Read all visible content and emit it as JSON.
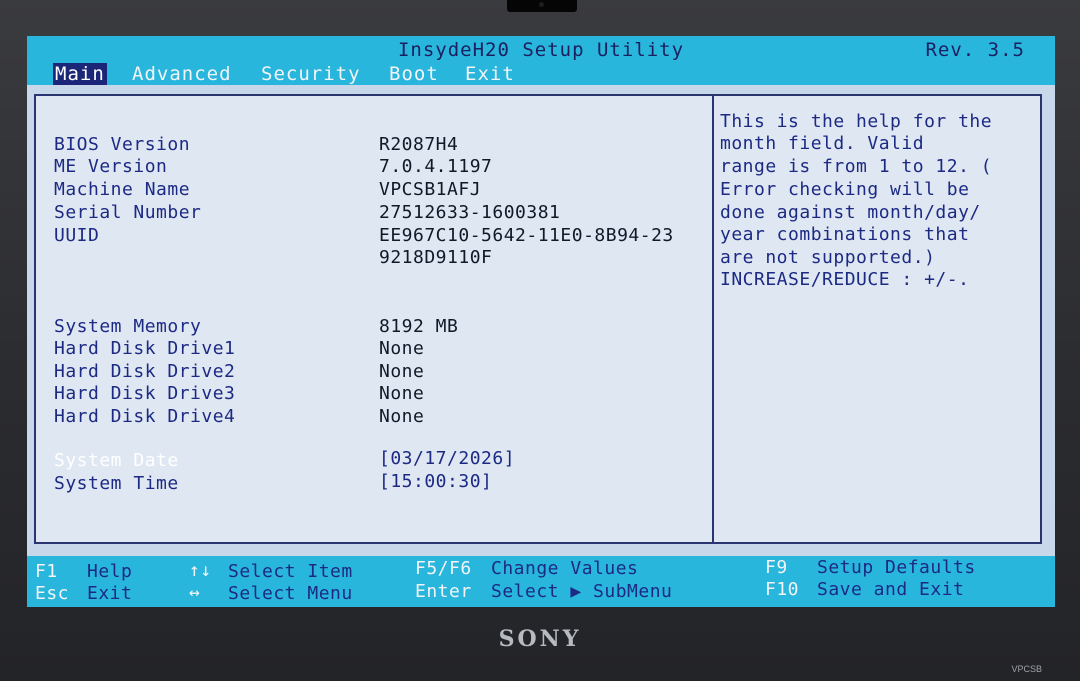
{
  "header": {
    "title": "InsydeH20 Setup Utility",
    "rev": "Rev. 3.5"
  },
  "menu": {
    "main": "Main",
    "advanced": "Advanced",
    "security": "Security",
    "boot": "Boot",
    "exit": "Exit"
  },
  "info": [
    {
      "label": "BIOS Version",
      "value": "R2087H4"
    },
    {
      "label": "ME Version",
      "value": "7.0.4.1197"
    },
    {
      "label": "Machine Name",
      "value": "VPCSB1AFJ"
    },
    {
      "label": "Serial Number",
      "value": "27512633-1600381"
    },
    {
      "label": "UUID",
      "value": "EE967C10-5642-11E0-8B94-23",
      "value2": "9218D9110F"
    }
  ],
  "hardware": [
    {
      "label": "System Memory",
      "value": "8192 MB"
    },
    {
      "label": "Hard Disk Drive1",
      "value": "None"
    },
    {
      "label": "Hard Disk Drive2",
      "value": "None"
    },
    {
      "label": "Hard Disk Drive3",
      "value": "None"
    },
    {
      "label": "Hard Disk Drive4",
      "value": "None"
    }
  ],
  "datetime": {
    "date_label": "System Date",
    "date_value": "[03/17/2026]",
    "time_label": "System Time",
    "time_value": "[15:00:30]"
  },
  "help": [
    "This is the help for the",
    "month field. Valid",
    "range is from 1 to 12. (",
    "Error checking will be",
    "done against month/day/",
    "year combinations that",
    "are not supported.)",
    "INCREASE/REDUCE : +/-."
  ],
  "footer": {
    "f1_key": "F1",
    "f1_desc": "Help",
    "esc_key": "Esc",
    "esc_desc": "Exit",
    "arrows_ud_key": "↑↓",
    "arrows_ud_desc": "Select Item",
    "arrows_lr_key": "↔",
    "arrows_lr_desc": "Select Menu",
    "f5f6_key": "F5/F6",
    "f5f6_desc": "Change Values",
    "enter_key": "Enter",
    "enter_desc": "Select ▶ SubMenu",
    "f9_key": "F9",
    "f9_desc": "Setup Defaults",
    "f10_key": "F10",
    "f10_desc": "Save and Exit"
  },
  "brand": {
    "logo": "SONY",
    "model": "VPCSB"
  },
  "colors": {
    "accent_cyan": "#29b6dc",
    "selection_navy": "#1c2678",
    "panel_bg": "#dfe7f2"
  }
}
